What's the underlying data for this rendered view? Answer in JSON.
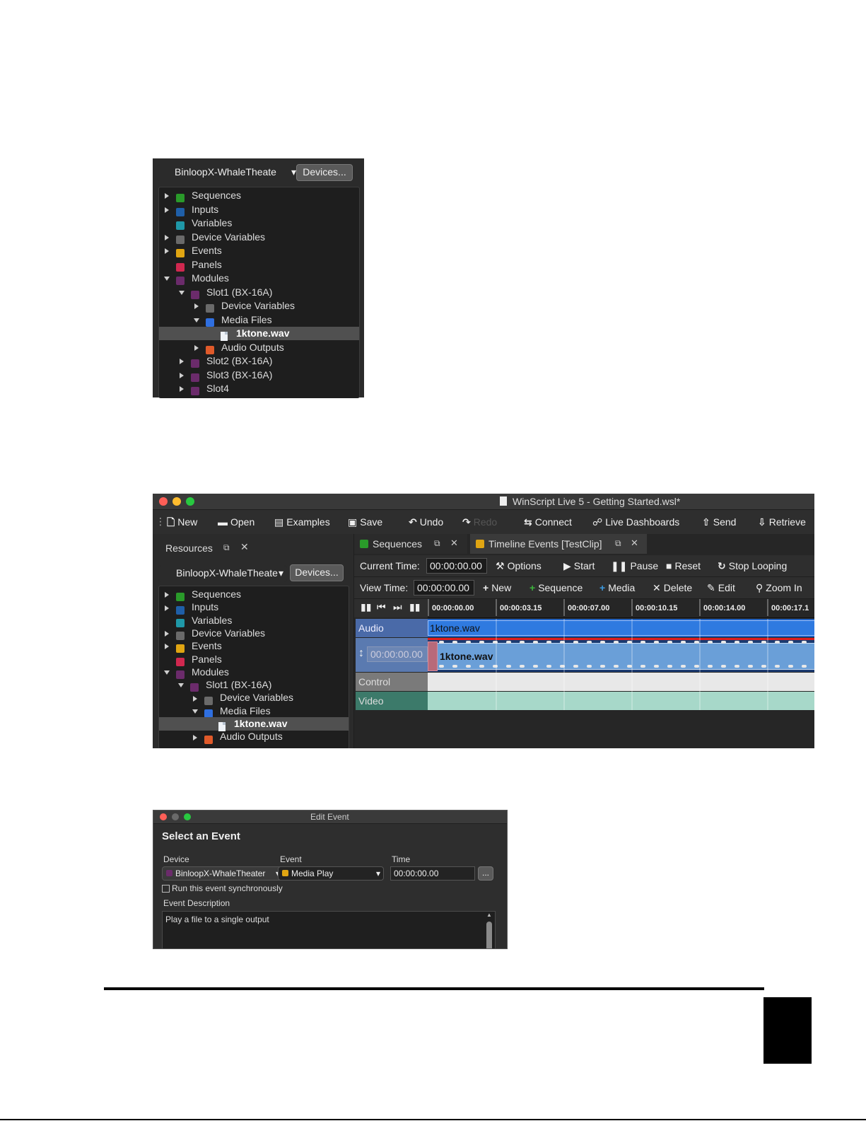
{
  "screenshot1": {
    "device_combo": "BinloopX-WhaleTheate",
    "devices_button": "Devices...",
    "tree": [
      {
        "label": "Sequences",
        "color": "#2a9a2a",
        "depth": 0,
        "twisty": "right",
        "icon": "green-square-icon"
      },
      {
        "label": "Inputs",
        "color": "#1f5fa8",
        "depth": 0,
        "twisty": "right",
        "icon": "blue-square-icon"
      },
      {
        "label": "Variables",
        "color": "#1f98a8",
        "depth": 0,
        "twisty": "none",
        "icon": "teal-square-icon"
      },
      {
        "label": "Device Variables",
        "color": "#6a6a6a",
        "depth": 0,
        "twisty": "right",
        "icon": "gray-square-icon"
      },
      {
        "label": "Events",
        "color": "#e0a512",
        "depth": 0,
        "twisty": "right",
        "icon": "yellow-square-icon"
      },
      {
        "label": "Panels",
        "color": "#d0284f",
        "depth": 0,
        "twisty": "none",
        "icon": "red-square-icon"
      },
      {
        "label": "Modules",
        "color": "#6b2b6b",
        "depth": 0,
        "twisty": "down",
        "icon": "purple-square-icon"
      },
      {
        "label": "Slot1 (BX-16A)",
        "color": "#6b2b6b",
        "depth": 1,
        "twisty": "down",
        "icon": "purple-square-icon"
      },
      {
        "label": "Device Variables",
        "color": "#6a6a6a",
        "depth": 2,
        "twisty": "right",
        "icon": "gray-square-icon"
      },
      {
        "label": "Media Files",
        "color": "#2f6fe0",
        "depth": 2,
        "twisty": "down",
        "icon": "blue-square-icon"
      },
      {
        "label": "1ktone.wav",
        "color": "",
        "depth": 3,
        "twisty": "none",
        "icon": "file-icon",
        "selected": true
      },
      {
        "label": "Audio Outputs",
        "color": "#e05a2a",
        "depth": 2,
        "twisty": "right",
        "icon": "orange-square-icon"
      },
      {
        "label": "Slot2 (BX-16A)",
        "color": "#6b2b6b",
        "depth": 1,
        "twisty": "right",
        "icon": "purple-square-icon"
      },
      {
        "label": "Slot3 (BX-16A)",
        "color": "#6b2b6b",
        "depth": 1,
        "twisty": "right",
        "icon": "purple-square-icon"
      },
      {
        "label": "Slot4",
        "color": "#6b2b6b",
        "depth": 1,
        "twisty": "right",
        "icon": "purple-square-icon"
      }
    ]
  },
  "screenshot2": {
    "window_title": "WinScript Live 5 - Getting Started.wsl*",
    "toolbar": {
      "new": "New",
      "open": "Open",
      "examples": "Examples",
      "save": "Save",
      "undo": "Undo",
      "redo": "Redo",
      "connect": "Connect",
      "live_dashboards": "Live Dashboards",
      "send": "Send",
      "retrieve": "Retrieve"
    },
    "resources_panel_title": "Resources",
    "device_combo": "BinloopX-WhaleTheate",
    "devices_button": "Devices...",
    "tree": [
      {
        "label": "Sequences",
        "color": "#2a9a2a",
        "depth": 0,
        "twisty": "right"
      },
      {
        "label": "Inputs",
        "color": "#1f5fa8",
        "depth": 0,
        "twisty": "right"
      },
      {
        "label": "Variables",
        "color": "#1f98a8",
        "depth": 0,
        "twisty": "none"
      },
      {
        "label": "Device Variables",
        "color": "#6a6a6a",
        "depth": 0,
        "twisty": "right"
      },
      {
        "label": "Events",
        "color": "#e0a512",
        "depth": 0,
        "twisty": "right"
      },
      {
        "label": "Panels",
        "color": "#d0284f",
        "depth": 0,
        "twisty": "none"
      },
      {
        "label": "Modules",
        "color": "#6b2b6b",
        "depth": 0,
        "twisty": "down"
      },
      {
        "label": "Slot1 (BX-16A)",
        "color": "#6b2b6b",
        "depth": 1,
        "twisty": "down"
      },
      {
        "label": "Device Variables",
        "color": "#6a6a6a",
        "depth": 2,
        "twisty": "right"
      },
      {
        "label": "Media Files",
        "color": "#2f6fe0",
        "depth": 2,
        "twisty": "down"
      },
      {
        "label": "1ktone.wav",
        "color": "",
        "depth": 3,
        "twisty": "none",
        "selected": true
      },
      {
        "label": "Audio Outputs",
        "color": "#e05a2a",
        "depth": 2,
        "twisty": "right"
      }
    ],
    "tabs": [
      {
        "label": "Sequences",
        "color": "#2a9a2a"
      },
      {
        "label": "Timeline Events [TestClip]",
        "color": "#e0a512"
      }
    ],
    "timeline_toolbar1": {
      "current_time_label": "Current Time:",
      "current_time": "00:00:00.00",
      "options": "Options",
      "start": "Start",
      "pause": "Pause",
      "reset": "Reset",
      "stop_looping": "Stop Looping"
    },
    "timeline_toolbar2": {
      "view_time_label": "View Time:",
      "view_time": "00:00:00.00",
      "new": "New",
      "sequence": "Sequence",
      "media": "Media",
      "delete": "Delete",
      "edit": "Edit",
      "zoom_in": "Zoom In"
    },
    "ruler_ticks": [
      "00:00:00.00",
      "00:00:03.15",
      "00:00:07.00",
      "00:00:10.15",
      "00:00:14.00",
      "00:00:17.1"
    ],
    "tracks": {
      "audio": "Audio",
      "audio_clip": "1ktone.wav",
      "sub_time": "00:00:00.00",
      "sub_clip": "1ktone.wav",
      "control": "Control",
      "video": "Video"
    },
    "colors": {
      "track_blue": "#2f7ae0",
      "audio_header": "#4a6aa8",
      "control_header": "#7a7a7a",
      "video_header": "#3c7a6a",
      "video_lane": "#a7d8c9"
    }
  },
  "screenshot3": {
    "window_title": "Edit Event",
    "heading": "Select an Event",
    "labels": {
      "device": "Device",
      "event": "Event",
      "time": "Time"
    },
    "device_value": "BinloopX-WhaleTheater",
    "event_value": "Media Play",
    "time_value": "00:00:00.00",
    "browse_button": "...",
    "sync_checkbox_label": "Run this event synchronously",
    "description_label": "Event Description",
    "description_text": "Play a file to a single output"
  }
}
